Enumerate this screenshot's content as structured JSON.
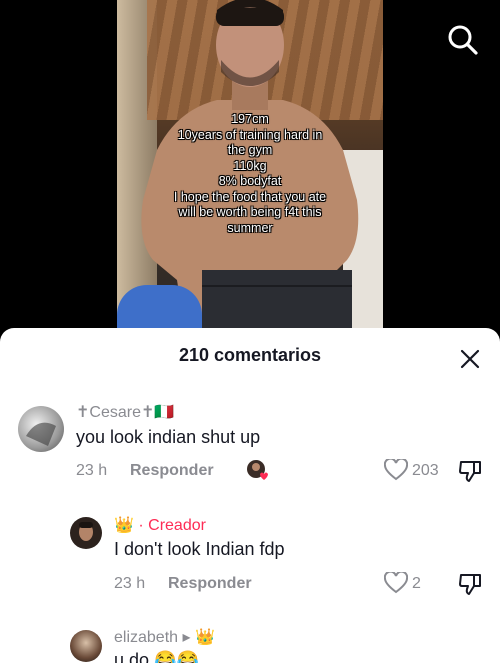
{
  "video": {
    "caption_lines": [
      "197cm",
      "10years of training hard in",
      "the gym",
      "110kg",
      "8% bodyfat",
      "I hope the food that you ate",
      "will be worth being f4t this",
      "summer"
    ]
  },
  "top_bar": {
    "search_icon": "search-icon"
  },
  "comments_panel": {
    "title": "210 comentarios",
    "close_icon": "close-icon",
    "comments": [
      {
        "username": "✝Cesare✝🇮🇹",
        "text": "you look indian shut up",
        "time": "23 h",
        "reply_label": "Responder",
        "likes": "203"
      },
      {
        "username": "👑 · Creador",
        "text": "I don't look Indian fdp",
        "time": "23 h",
        "reply_label": "Responder",
        "likes": "2"
      },
      {
        "username": "elizabeth ▸ 👑",
        "text": "u do 😂😂"
      }
    ]
  },
  "colors": {
    "accent": "#fe2c55",
    "muted": "#8a8b91",
    "text": "#161823"
  }
}
